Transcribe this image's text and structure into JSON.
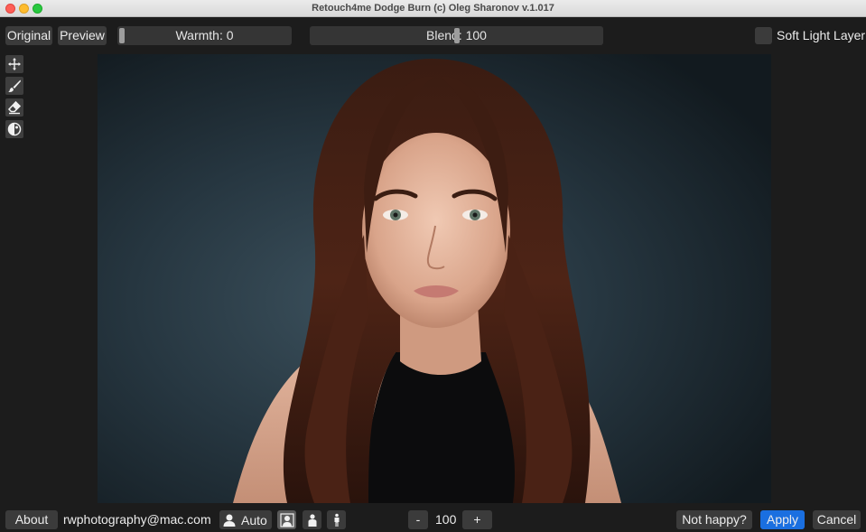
{
  "window": {
    "title": "Retouch4me Dodge Burn (c) Oleg Sharonov v.1.017"
  },
  "toolbar": {
    "original_label": "Original",
    "preview_label": "Preview",
    "warmth_label": "Warmth: 0",
    "warmth_value": 0,
    "blend_label": "Blend: 100",
    "blend_value": 100,
    "soft_light_label": "Soft Light Layer",
    "soft_light_checked": false
  },
  "tools": [
    {
      "name": "move-icon"
    },
    {
      "name": "brush-icon"
    },
    {
      "name": "eraser-icon"
    },
    {
      "name": "contrast-icon"
    }
  ],
  "footer": {
    "about_label": "About",
    "account_email": "rwphotography@mac.com",
    "auto_label": "Auto",
    "minus_label": "-",
    "zoom_value": "100",
    "plus_label": "+",
    "not_happy_label": "Not happy?",
    "apply_label": "Apply",
    "cancel_label": "Cancel"
  },
  "colors": {
    "accent": "#1a6fe0",
    "panel": "#1c1c1c",
    "control": "#3b3b3b"
  }
}
